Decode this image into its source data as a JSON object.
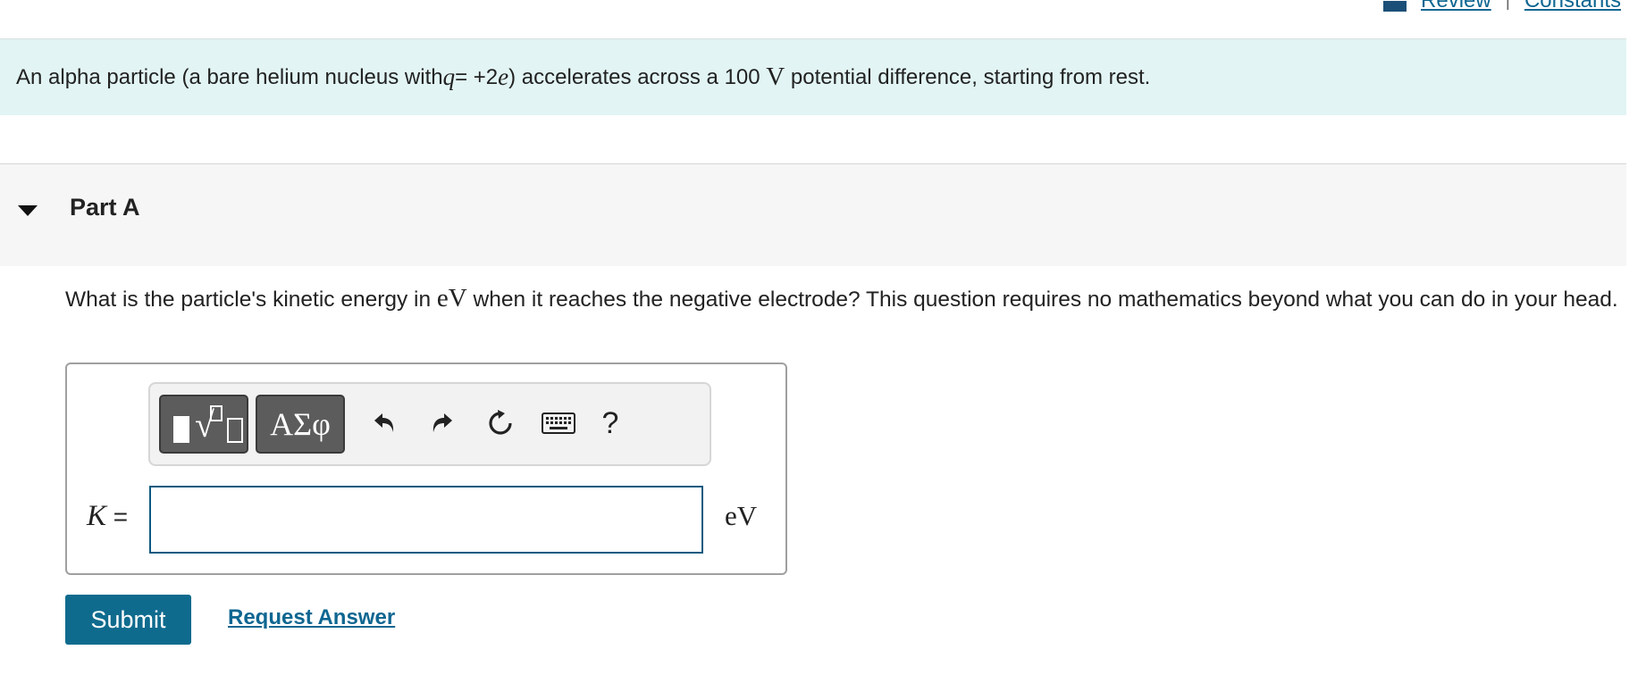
{
  "top_links": {
    "review": "Review",
    "separator": "|",
    "constants": "Constants"
  },
  "intro": {
    "text_before": "An alpha particle (a bare helium nucleus with ",
    "q_var": "q",
    "q_value": " = +2",
    "e_var": "e",
    "text_middle": ") accelerates across a 100 ",
    "unit_v": "V",
    "text_after": " potential difference, starting from rest."
  },
  "part": {
    "title": "Part A"
  },
  "question": {
    "text_before": "What is the particle's kinetic energy in ",
    "unit": "eV",
    "text_after": " when it reaches the negative electrode? This question requires no mathematics beyond what you can do in your head."
  },
  "toolbar": {
    "symbols_label": "ΑΣφ",
    "help_label": "?"
  },
  "answer": {
    "var": "K",
    "equals": " =",
    "value": "",
    "unit": "eV"
  },
  "actions": {
    "submit_label": "Submit",
    "request_label": "Request Answer"
  },
  "colors": {
    "intro_bg": "#e2f4f4",
    "part_bg": "#f6f6f6",
    "accent": "#0f6b8e",
    "link": "#0e6691"
  }
}
